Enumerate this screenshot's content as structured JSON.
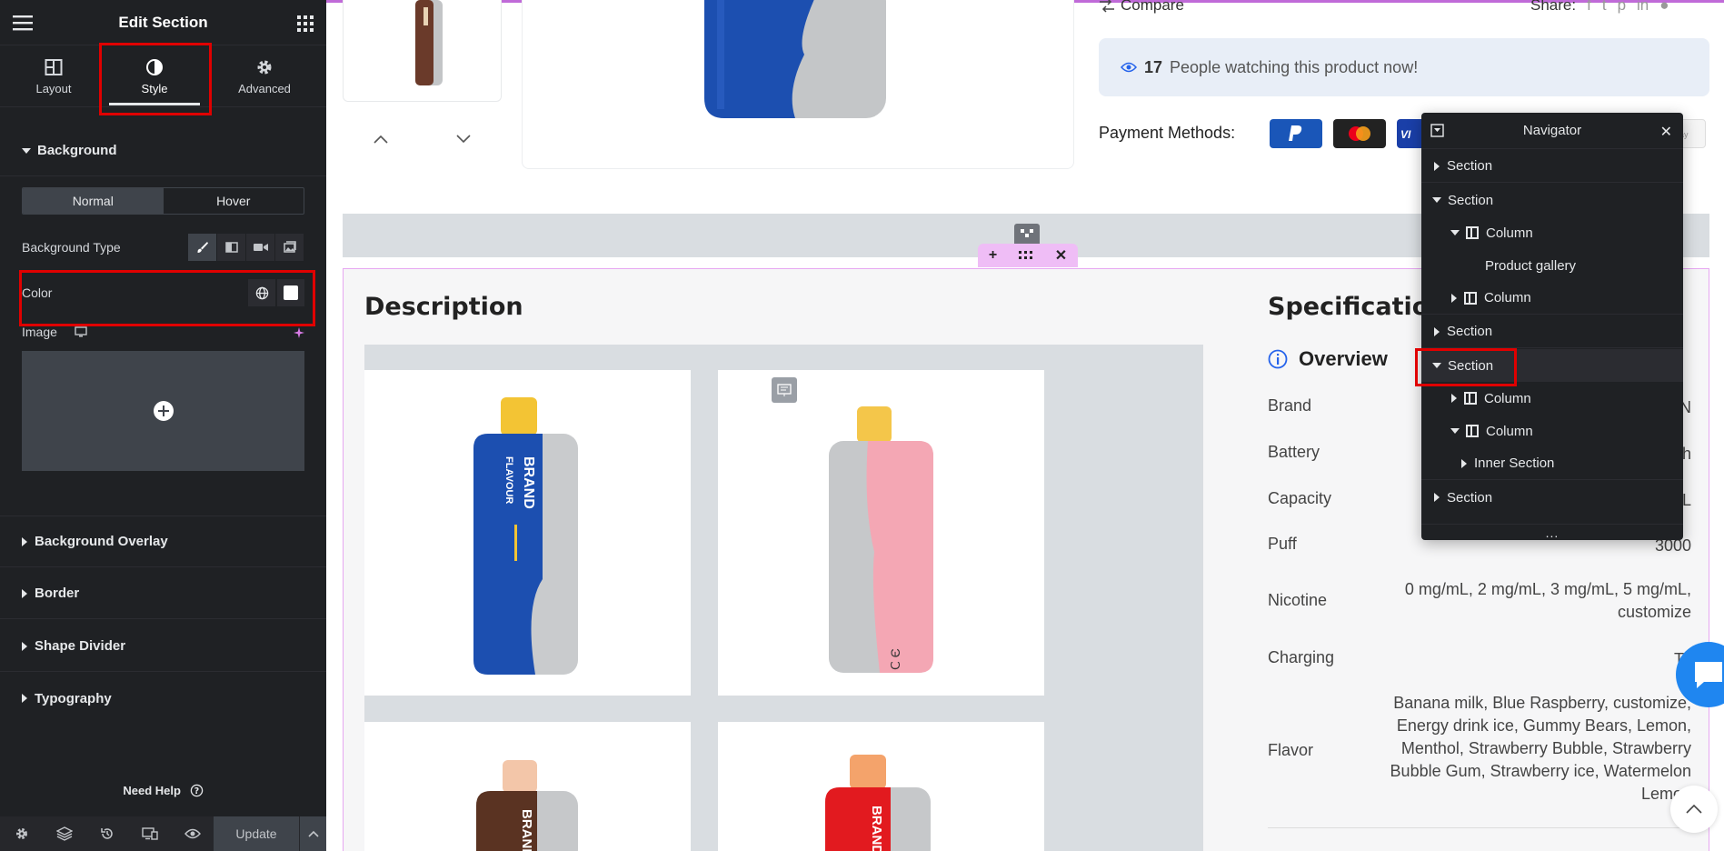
{
  "panel": {
    "title": "Edit Section",
    "tabs": [
      {
        "label": "Layout",
        "icon": "layout-icon"
      },
      {
        "label": "Style",
        "icon": "contrast-icon",
        "active": true
      },
      {
        "label": "Advanced",
        "icon": "gear-icon"
      }
    ],
    "sections": {
      "background": "Background",
      "background_overlay": "Background Overlay",
      "border": "Border",
      "shape_divider": "Shape Divider",
      "typography": "Typography"
    },
    "state_toggle": {
      "normal": "Normal",
      "hover": "Hover",
      "selected": "Normal"
    },
    "background_type_label": "Background Type",
    "color_label": "Color",
    "image_label": "Image",
    "need_help": "Need Help",
    "update": "Update"
  },
  "canvas": {
    "compare": "Compare",
    "share": "Share:",
    "watching": {
      "count": "17",
      "text": "People watching this product now!"
    },
    "payment_label": "Payment Methods:",
    "description_title": "Description",
    "spec_title": "Specification",
    "overview": "Overview",
    "specs": [
      {
        "key": "Brand",
        "value": "N"
      },
      {
        "key": "Battery",
        "value": "h"
      },
      {
        "key": "Capacity",
        "value": "L"
      },
      {
        "key": "Puff",
        "value": "3000"
      },
      {
        "key": "Nicotine",
        "value": "0 mg/mL, 2 mg/mL, 3 mg/mL, 5 mg/mL, customize"
      },
      {
        "key": "Charging",
        "value": "Ty"
      },
      {
        "key": "Flavor",
        "value": "Banana milk, Blue Raspberry, customize, Energy drink ice, Gummy Bears, Lemon, Menthol, Strawberry Bubble, Strawberry Bubble Gum, Strawberry ice, Watermelon Lemon"
      }
    ],
    "product_text": {
      "brand": "BRAND",
      "flavour": "FLAVOUR"
    }
  },
  "navigator": {
    "title": "Navigator",
    "items": [
      {
        "label": "Section",
        "level": 0,
        "expanded": false
      },
      {
        "label": "Section",
        "level": 0,
        "expanded": true
      },
      {
        "label": "Column",
        "level": 1,
        "expanded": true
      },
      {
        "label": "Product gallery",
        "level": 2
      },
      {
        "label": "Column",
        "level": 1,
        "expanded": false
      },
      {
        "label": "Section",
        "level": 0,
        "expanded": false
      },
      {
        "label": "Section",
        "level": 0,
        "expanded": true,
        "selected": true
      },
      {
        "label": "Column",
        "level": 1,
        "expanded": false
      },
      {
        "label": "Column",
        "level": 1,
        "expanded": true
      },
      {
        "label": "Inner Section",
        "level": 2,
        "expanded": false
      },
      {
        "label": "Section",
        "level": 0,
        "expanded": false
      }
    ],
    "more": "..."
  },
  "colors": {
    "panel_bg": "#1f2124",
    "highlight": "#e00000",
    "section_outline": "#e7a7f2",
    "accent_blue": "#1f86f0"
  }
}
